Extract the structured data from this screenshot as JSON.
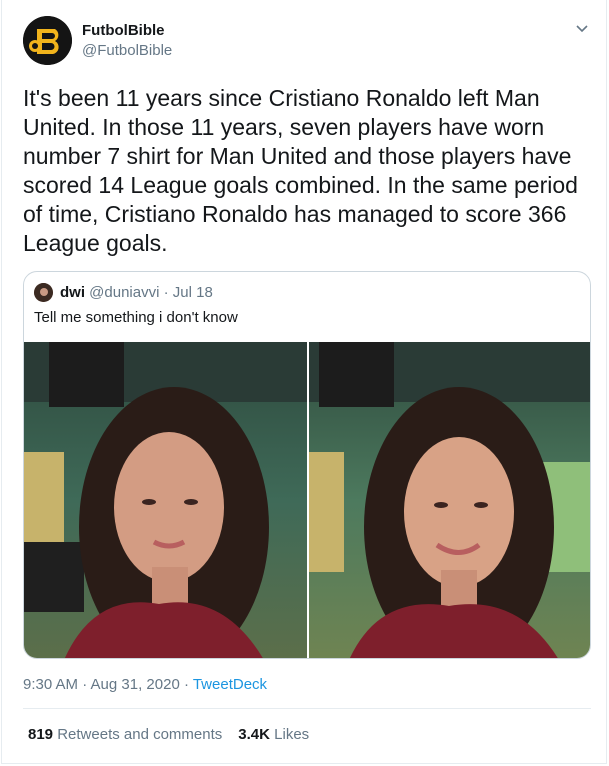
{
  "account": {
    "name": "FutbolBible",
    "handle": "@FutbolBible",
    "avatar_icon": "futbolbible-logo-icon"
  },
  "tweet": {
    "text": "It's been 11 years since Cristiano Ronaldo left Man United. In those 11 years, seven players have worn number 7 shirt for Man United and those players have scored 14 League goals combined. In the same period of time, Cristiano Ronaldo has managed to score 366 League goals.",
    "time": "9:30 AM · Aug 31, 2020 · ",
    "source": "TweetDeck"
  },
  "quoted": {
    "name": "dwi",
    "handle": "@duniavvi",
    "date": " · Jul 18",
    "text": "Tell me something i don't know"
  },
  "stats": {
    "retweets_count": "819",
    "retweets_label": "Retweets and comments",
    "likes_count": "3.4K",
    "likes_label": "Likes"
  },
  "colors": {
    "text": "#14171a",
    "muted": "#657786",
    "link": "#1b95e0",
    "border": "#e6ecf0"
  }
}
